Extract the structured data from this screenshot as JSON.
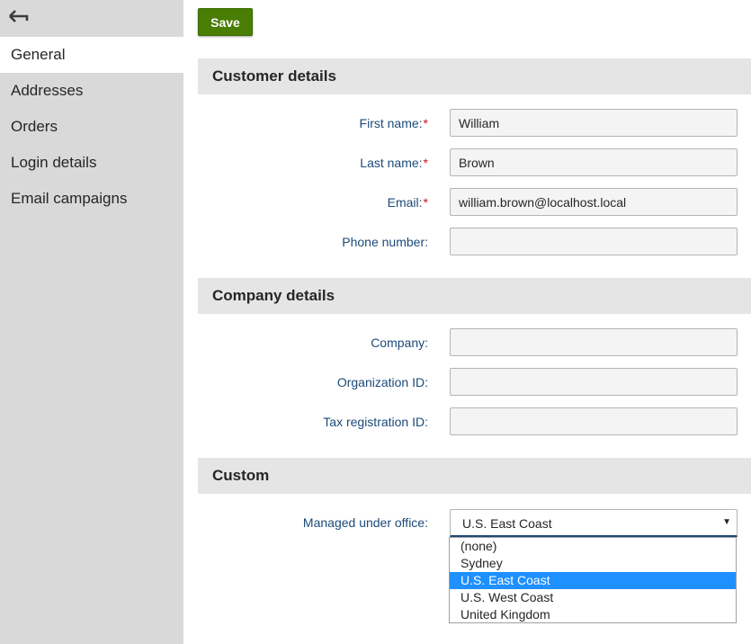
{
  "sidebar": {
    "back_icon": "arrow-left-icon",
    "items": [
      {
        "label": "General"
      },
      {
        "label": "Addresses"
      },
      {
        "label": "Orders"
      },
      {
        "label": "Login details"
      },
      {
        "label": "Email campaigns"
      }
    ],
    "active": "General"
  },
  "toolbar": {
    "save_label": "Save"
  },
  "sections": {
    "customer": {
      "title": "Customer details",
      "fields": {
        "first_name": {
          "label": "First name:",
          "required": "*",
          "value": "William"
        },
        "last_name": {
          "label": "Last name:",
          "required": "*",
          "value": "Brown"
        },
        "email": {
          "label": "Email:",
          "required": "*",
          "value": "william.brown@localhost.local"
        },
        "phone": {
          "label": "Phone number:",
          "value": ""
        }
      }
    },
    "company": {
      "title": "Company details",
      "fields": {
        "company": {
          "label": "Company:",
          "value": ""
        },
        "organization_id": {
          "label": "Organization ID:",
          "value": ""
        },
        "tax_id": {
          "label": "Tax registration ID:",
          "value": ""
        }
      }
    },
    "custom": {
      "title": "Custom",
      "managed_office": {
        "label": "Managed under office:",
        "selected": "U.S. East Coast",
        "options": [
          "(none)",
          "Sydney",
          "U.S. East Coast",
          "U.S. West Coast",
          "United Kingdom"
        ]
      }
    }
  },
  "colors": {
    "save_button": "#497d04",
    "label": "#1c4a79",
    "required": "#d0121a",
    "selected_option": "#1e90ff",
    "sidebar": "#d8d9d8"
  }
}
